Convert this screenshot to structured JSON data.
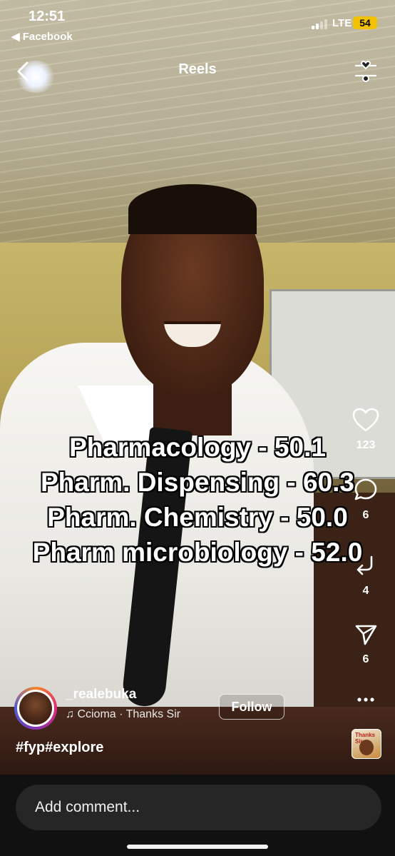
{
  "status_bar": {
    "time": "12:51",
    "back_app": "◀ Facebook",
    "network": "LTE",
    "battery": "54"
  },
  "header": {
    "title": "Reels"
  },
  "overlay_text": [
    "Pharmacology - 50.1",
    "Pharm. Dispensing - 60.3",
    "Pharm. Chemistry - 50.0",
    "Pharm microbiology - 52.0"
  ],
  "actions": {
    "likes": "123",
    "comments": "6",
    "reposts": "4",
    "shares": "6"
  },
  "author": {
    "username": "_realebuka",
    "audio": "♫ Ccioma · Thanks Sir",
    "follow_label": "Follow"
  },
  "caption": "#fyp#explore",
  "audio_thumb": {
    "text": "Thanks Sir"
  },
  "comment_input": {
    "placeholder": "Add comment..."
  },
  "colors": {
    "battery": "#f2c200",
    "comment_box": "#262626"
  }
}
